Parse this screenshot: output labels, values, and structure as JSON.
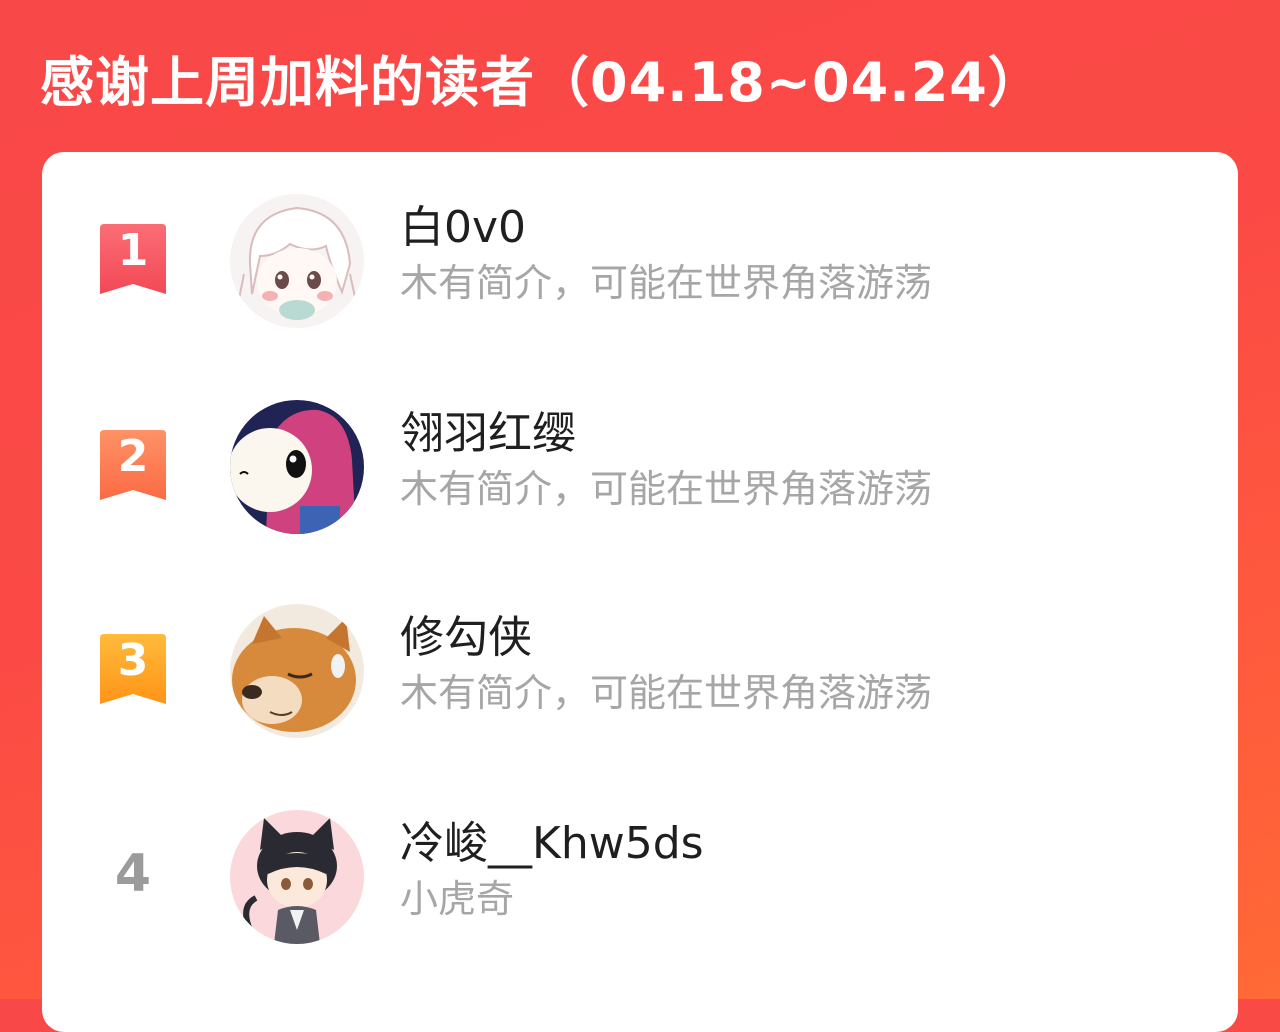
{
  "header": {
    "title": "感谢上周加料的读者（04.18~04.24）"
  },
  "colors": {
    "background": "#f84848",
    "rank1": "#f6525d",
    "rank2": "#fd7a4c",
    "rank3": "#ffa326",
    "rank_plain": "#9b9b9b",
    "name": "#1f1f1f",
    "bio": "#a6a6a6"
  },
  "readers": [
    {
      "rank": "1",
      "name": "白0v0",
      "bio": "木有简介，可能在世界角落游荡",
      "avatar_icon": "anime-girl-avatar"
    },
    {
      "rank": "2",
      "name": "翎羽红缨",
      "bio": "木有简介，可能在世界角落游荡",
      "avatar_icon": "cartoon-character-avatar"
    },
    {
      "rank": "3",
      "name": "修勾侠",
      "bio": "木有简介，可能在世界角落游荡",
      "avatar_icon": "shiba-dog-avatar"
    },
    {
      "rank": "4",
      "name": "冷峻__Khw5ds",
      "bio": "小虎奇",
      "avatar_icon": "cat-ear-boy-avatar"
    }
  ]
}
